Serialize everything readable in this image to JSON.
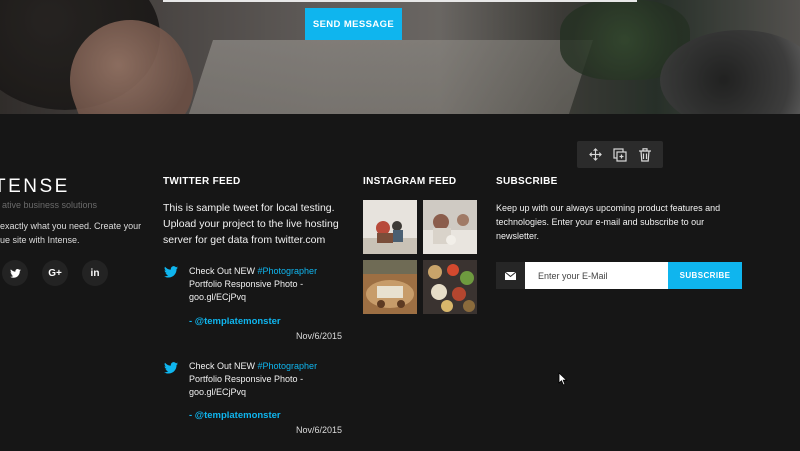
{
  "hero": {
    "send_label": "SEND MESSAGE"
  },
  "toolbar": {
    "move": "move-icon",
    "duplicate": "duplicate-icon",
    "delete": "trash-icon"
  },
  "brand": {
    "name": "TENSE",
    "tagline": "ative business solutions",
    "text": "exactly what you need. Create your ue site with Intense.",
    "social": [
      {
        "icon": "twitter-icon",
        "label": ""
      },
      {
        "icon": "google-plus-icon",
        "label": "G+"
      },
      {
        "icon": "linkedin-icon",
        "label": "in"
      }
    ]
  },
  "twitter": {
    "heading": "TWITTER FEED",
    "intro": "This is sample tweet for local testing. Upload your project to the live hosting server for get data from twitter.com",
    "tweets": [
      {
        "prefix": "Check Out NEW ",
        "tag": "#Photographer",
        "suffix": " Portfolio Responsive Photo - goo.gl/ECjPvq",
        "handle": "- @templatemonster",
        "date": "Nov/6/2015"
      },
      {
        "prefix": "Check Out NEW ",
        "tag": "#Photographer",
        "suffix": " Portfolio Responsive Photo - goo.gl/ECjPvq",
        "handle": "- @templatemonster",
        "date": "Nov/6/2015"
      }
    ]
  },
  "instagram": {
    "heading": "INSTAGRAM FEED"
  },
  "subscribe": {
    "heading": "SUBSCRIBE",
    "text": "Keep up with our always upcoming product features and technologies. Enter your e-mail and subscribe to our newsletter.",
    "placeholder": "Enter your E-Mail",
    "button": "SUBSCRIBE"
  },
  "colors": {
    "accent": "#0fb5ee",
    "footer_bg": "#161616"
  }
}
